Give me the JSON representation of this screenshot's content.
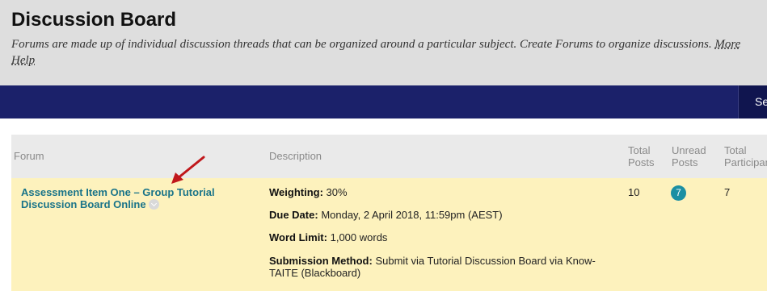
{
  "header": {
    "title": "Discussion Board",
    "description": "Forums are made up of individual discussion threads that can be organized around a particular subject. Create Forums to organize discussions.",
    "more_label": "More",
    "help_label": "Help"
  },
  "navbar": {
    "button_label": "Search"
  },
  "table": {
    "columns": {
      "forum": "Forum",
      "description": "Description",
      "total_posts": "Total Posts",
      "unread_posts": "Unread Posts",
      "total_participants": "Total Participants"
    },
    "rows": [
      {
        "forum": "Assessment Item One – Group Tutorial Discussion Board Online",
        "weighting_label": "Weighting:",
        "weighting_value": "30%",
        "due_label": "Due Date:",
        "due_value": "Monday, 2 April 2018, 11:59pm (AEST)",
        "word_label": "Word Limit:",
        "word_value": "1,000 words",
        "submission_label": "Submission Method:",
        "submission_value": "Submit via Tutorial Discussion Board via Know-TAITE (Blackboard)",
        "total_posts": "10",
        "unread_posts": "7",
        "total_participants": "7"
      }
    ]
  },
  "annotation": {
    "arrow_color": "#c0171b"
  }
}
